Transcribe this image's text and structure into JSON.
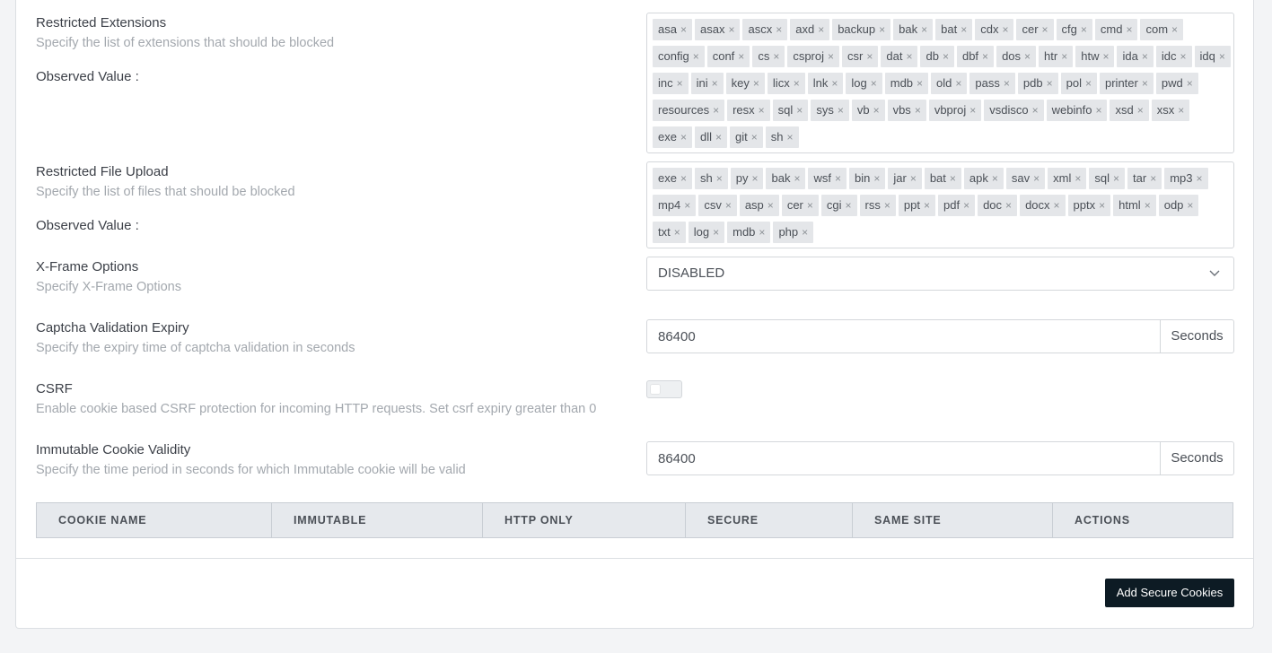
{
  "restricted_extensions": {
    "title": "Restricted Extensions",
    "description": "Specify the list of extensions that should be blocked",
    "observed_label": "Observed Value :",
    "tags": [
      "asa",
      "asax",
      "ascx",
      "axd",
      "backup",
      "bak",
      "bat",
      "cdx",
      "cer",
      "cfg",
      "cmd",
      "com",
      "config",
      "conf",
      "cs",
      "csproj",
      "csr",
      "dat",
      "db",
      "dbf",
      "dos",
      "htr",
      "htw",
      "ida",
      "idc",
      "idq",
      "inc",
      "ini",
      "key",
      "licx",
      "lnk",
      "log",
      "mdb",
      "old",
      "pass",
      "pdb",
      "pol",
      "printer",
      "pwd",
      "resources",
      "resx",
      "sql",
      "sys",
      "vb",
      "vbs",
      "vbproj",
      "vsdisco",
      "webinfo",
      "xsd",
      "xsx",
      "exe",
      "dll",
      "git",
      "sh"
    ]
  },
  "restricted_file_upload": {
    "title": "Restricted File Upload",
    "description": "Specify the list of files that should be blocked",
    "observed_label": "Observed Value :",
    "tags": [
      "exe",
      "sh",
      "py",
      "bak",
      "wsf",
      "bin",
      "jar",
      "bat",
      "apk",
      "sav",
      "xml",
      "sql",
      "tar",
      "mp3",
      "mp4",
      "csv",
      "asp",
      "cer",
      "cgi",
      "rss",
      "ppt",
      "pdf",
      "doc",
      "docx",
      "pptx",
      "html",
      "odp",
      "txt",
      "log",
      "mdb",
      "php"
    ]
  },
  "x_frame_options": {
    "title": "X-Frame Options",
    "description": "Specify X-Frame Options",
    "value": "DISABLED"
  },
  "captcha_expiry": {
    "title": "Captcha Validation Expiry",
    "description": "Specify the expiry time of captcha validation in seconds",
    "value": "86400",
    "unit": "Seconds"
  },
  "csrf": {
    "title": "CSRF",
    "description": "Enable cookie based CSRF protection for incoming HTTP requests. Set csrf expiry greater than 0",
    "enabled": false
  },
  "immutable_cookie": {
    "title": "Immutable Cookie Validity",
    "description": "Specify the time period in seconds for which Immutable cookie will be valid",
    "value": "86400",
    "unit": "Seconds"
  },
  "cookie_table": {
    "headers": [
      "COOKIE NAME",
      "IMMUTABLE",
      "HTTP ONLY",
      "SECURE",
      "SAME SITE",
      "ACTIONS"
    ]
  },
  "add_button": "Add Secure Cookies",
  "tag_remove_glyph": "×"
}
